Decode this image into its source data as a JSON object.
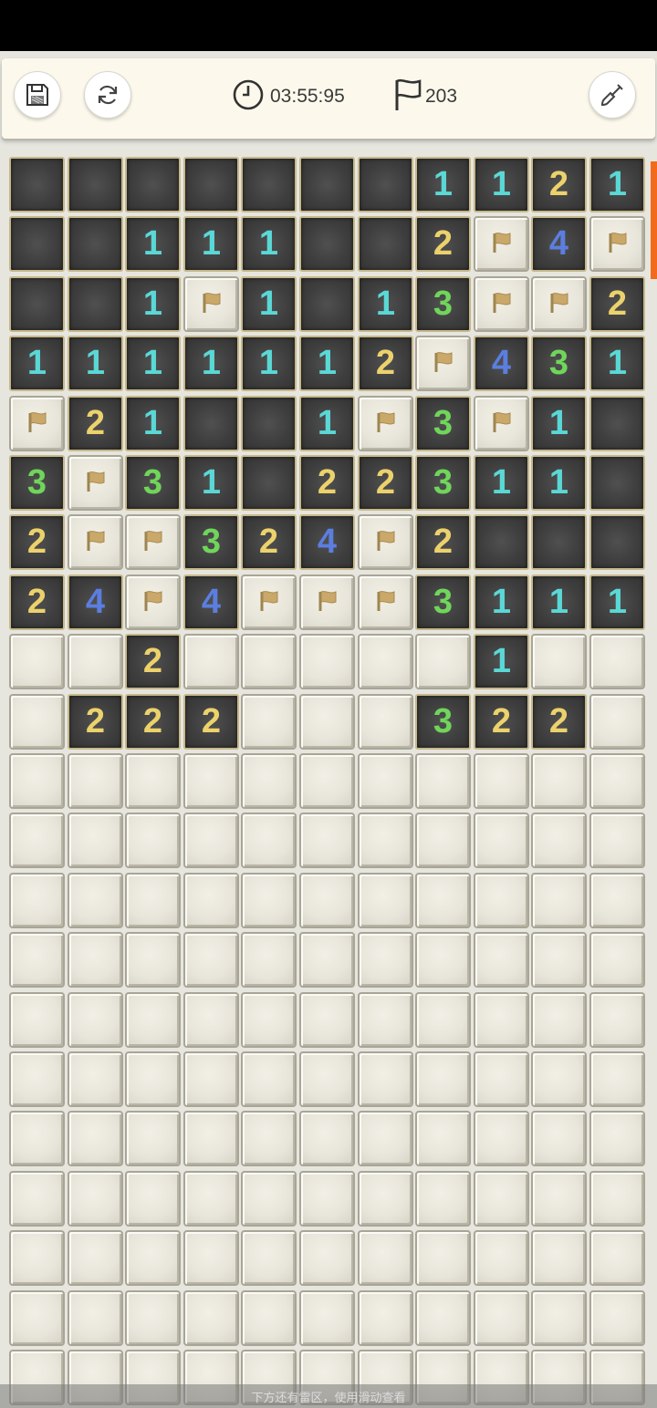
{
  "toolbar": {
    "save_icon": "save-icon",
    "restart_icon": "restart-icon",
    "timer": "03:55:95",
    "flag_count": "203",
    "dig_icon": "shovel-icon"
  },
  "colors": {
    "1": "#5ad8d6",
    "2": "#ecd26c",
    "3": "#6fd65a",
    "4": "#5b7ee0",
    "scroll": "#f26a1b"
  },
  "board": {
    "columns": 11,
    "rows": [
      [
        "o",
        "o",
        "o",
        "o",
        "o",
        "o",
        "o",
        "1",
        "1",
        "2",
        "1"
      ],
      [
        "o",
        "o",
        "1",
        "1",
        "1",
        "o",
        "o",
        "2",
        "F",
        "4",
        "F"
      ],
      [
        "o",
        "o",
        "1",
        "F",
        "1",
        "o",
        "1",
        "3",
        "F",
        "F",
        "2"
      ],
      [
        "1",
        "1",
        "1",
        "1",
        "1",
        "1",
        "2",
        "F",
        "4",
        "3",
        "1"
      ],
      [
        "F",
        "2",
        "1",
        "o",
        "o",
        "1",
        "F",
        "3",
        "F",
        "1",
        "o"
      ],
      [
        "3",
        "F",
        "3",
        "1",
        "o",
        "2",
        "2",
        "3",
        "1",
        "1",
        "o"
      ],
      [
        "2",
        "F",
        "F",
        "3",
        "2",
        "4",
        "F",
        "2",
        "o",
        "o",
        "o"
      ],
      [
        "2",
        "4",
        "F",
        "4",
        "F",
        "F",
        "F",
        "3",
        "1",
        "1",
        "1"
      ],
      [
        "c",
        "c",
        "2",
        "c",
        "c",
        "c",
        "c",
        "c",
        "1",
        "c",
        "c"
      ],
      [
        "c",
        "2",
        "2",
        "2",
        "c",
        "c",
        "c",
        "3",
        "2",
        "2",
        "c"
      ],
      [
        "c",
        "c",
        "c",
        "c",
        "c",
        "c",
        "c",
        "c",
        "c",
        "c",
        "c"
      ],
      [
        "c",
        "c",
        "c",
        "c",
        "c",
        "c",
        "c",
        "c",
        "c",
        "c",
        "c"
      ],
      [
        "c",
        "c",
        "c",
        "c",
        "c",
        "c",
        "c",
        "c",
        "c",
        "c",
        "c"
      ],
      [
        "c",
        "c",
        "c",
        "c",
        "c",
        "c",
        "c",
        "c",
        "c",
        "c",
        "c"
      ],
      [
        "c",
        "c",
        "c",
        "c",
        "c",
        "c",
        "c",
        "c",
        "c",
        "c",
        "c"
      ],
      [
        "c",
        "c",
        "c",
        "c",
        "c",
        "c",
        "c",
        "c",
        "c",
        "c",
        "c"
      ],
      [
        "c",
        "c",
        "c",
        "c",
        "c",
        "c",
        "c",
        "c",
        "c",
        "c",
        "c"
      ],
      [
        "c",
        "c",
        "c",
        "c",
        "c",
        "c",
        "c",
        "c",
        "c",
        "c",
        "c"
      ],
      [
        "c",
        "c",
        "c",
        "c",
        "c",
        "c",
        "c",
        "c",
        "c",
        "c",
        "c"
      ],
      [
        "c",
        "c",
        "c",
        "c",
        "c",
        "c",
        "c",
        "c",
        "c",
        "c",
        "c"
      ],
      [
        "c",
        "c",
        "c",
        "c",
        "c",
        "c",
        "c",
        "c",
        "c",
        "c",
        "c"
      ]
    ]
  },
  "hint": "下方还有雷区，使用滑动查看"
}
